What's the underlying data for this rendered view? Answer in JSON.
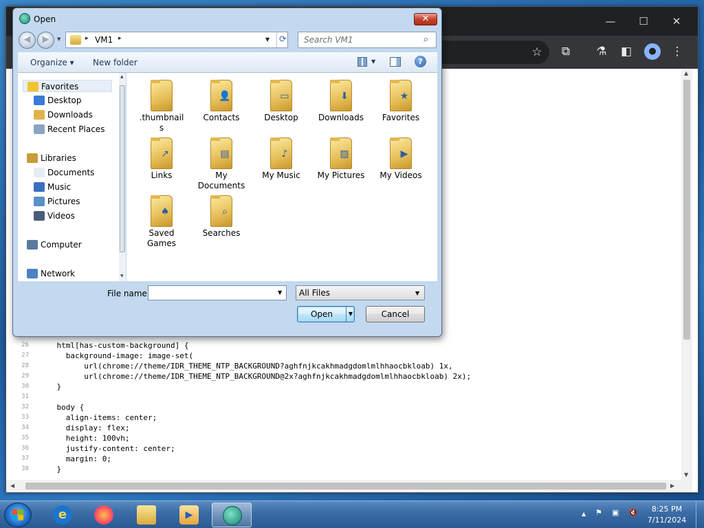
{
  "dialog": {
    "title": "Open",
    "address": {
      "root_sep": "▸",
      "path": "VM1",
      "trail_sep": "▸"
    },
    "search_placeholder": "Search VM1",
    "commands": {
      "organize": "Organize ▾",
      "new_folder": "New folder"
    },
    "nav": [
      {
        "label": "Favorites",
        "icon": "star-icon",
        "indent": 0
      },
      {
        "label": "Desktop",
        "icon": "desktop-icon",
        "indent": 1
      },
      {
        "label": "Downloads",
        "icon": "downloads-icon",
        "indent": 1
      },
      {
        "label": "Recent Places",
        "icon": "recent-places-icon",
        "indent": 1
      },
      {
        "label": "Libraries",
        "icon": "libraries-icon",
        "indent": 0
      },
      {
        "label": "Documents",
        "icon": "documents-icon",
        "indent": 1
      },
      {
        "label": "Music",
        "icon": "music-icon",
        "indent": 1
      },
      {
        "label": "Pictures",
        "icon": "pictures-icon",
        "indent": 1
      },
      {
        "label": "Videos",
        "icon": "videos-icon",
        "indent": 1
      },
      {
        "label": "Computer",
        "icon": "computer-icon",
        "indent": 0
      },
      {
        "label": "Network",
        "icon": "network-icon",
        "indent": 0
      }
    ],
    "files": [
      {
        "label": ".thumbnail\ns",
        "icon": "folder-icon"
      },
      {
        "label": "Contacts",
        "icon": "contacts-folder-icon"
      },
      {
        "label": "Desktop",
        "icon": "desktop-folder-icon"
      },
      {
        "label": "Downloads",
        "icon": "downloads-folder-icon"
      },
      {
        "label": "Favorites",
        "icon": "favorites-folder-icon"
      },
      {
        "label": "Links",
        "icon": "links-folder-icon"
      },
      {
        "label": "My\nDocuments",
        "icon": "documents-folder-icon"
      },
      {
        "label": "My Music",
        "icon": "music-folder-icon"
      },
      {
        "label": "My Pictures",
        "icon": "pictures-folder-icon"
      },
      {
        "label": "My Videos",
        "icon": "videos-folder-icon"
      },
      {
        "label": "Saved\nGames",
        "icon": "saved-games-folder-icon"
      },
      {
        "label": "Searches",
        "icon": "searches-folder-icon"
      }
    ],
    "file_name_label": "File name:",
    "file_name_value": "",
    "file_type": "All Files",
    "open_label": "Open",
    "cancel_label": "Cancel"
  },
  "editor": {
    "lines": [
      {
        "n": "26",
        "t": "    html[has-custom-background] {"
      },
      {
        "n": "27",
        "t": "      background-image: image-set("
      },
      {
        "n": "28",
        "t": "          url(chrome://theme/IDR_THEME_NTP_BACKGROUND?aghfnjkcakhmadgdomlmlhhaocbkloab) 1x,"
      },
      {
        "n": "29",
        "t": "          url(chrome://theme/IDR_THEME_NTP_BACKGROUND@2x?aghfnjkcakhmadgdomlmlhhaocbkloab) 2x);"
      },
      {
        "n": "30",
        "t": "    }"
      },
      {
        "n": "31",
        "t": ""
      },
      {
        "n": "32",
        "t": "    body {"
      },
      {
        "n": "33",
        "t": "      align-items: center;"
      },
      {
        "n": "34",
        "t": "      display: flex;"
      },
      {
        "n": "35",
        "t": "      height: 100vh;"
      },
      {
        "n": "36",
        "t": "      justify-content: center;"
      },
      {
        "n": "37",
        "t": "      margin: 0;"
      },
      {
        "n": "38",
        "t": "    }"
      }
    ]
  },
  "browser": {
    "icons": [
      "star-icon",
      "extensions-icon",
      "labs-icon",
      "sidepanel-icon",
      "profile-icon",
      "menu-icon"
    ]
  },
  "taskbar": {
    "apps": [
      "internet-explorer-icon",
      "firefox-icon",
      "explorer-icon",
      "media-player-icon",
      "app-icon"
    ],
    "time": "8:25 PM",
    "date": "7/11/2024"
  }
}
